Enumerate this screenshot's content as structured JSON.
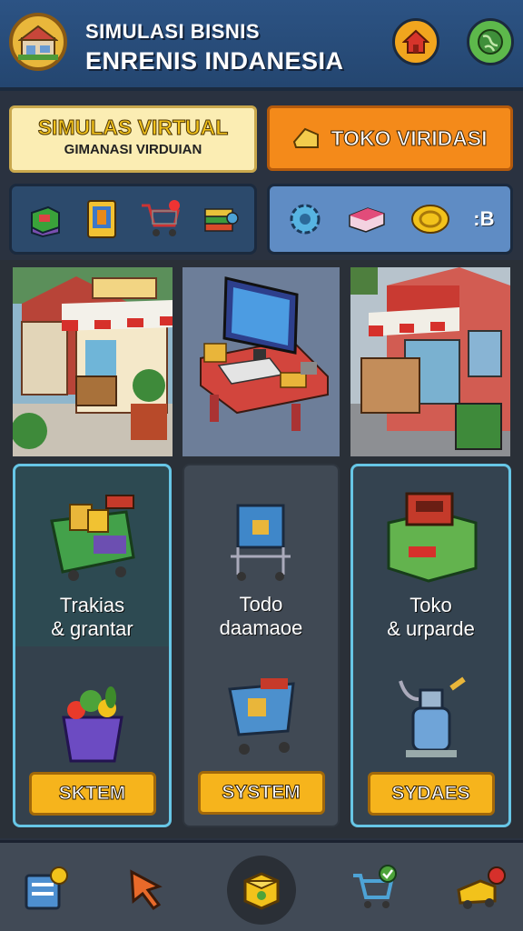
{
  "header": {
    "title_line1": "SIMULASI BISNIS",
    "title_line2": "ENRENIS INDANESIA",
    "logo_icon": "shop-house-icon",
    "home_icon": "home-icon",
    "globe_icon": "globe-icon"
  },
  "top_buttons": {
    "virtual_main": "SIMULAS VIRTUAL",
    "virtual_sub": "GIMANASI VIRDUIAN",
    "toko_label": "TOKO VIRIDASI"
  },
  "icon_bar_left": [
    "crate-icon",
    "card-icon",
    "cart-icon",
    "stack-icon"
  ],
  "icon_bar_right": {
    "icons": [
      "gear-icon",
      "box-icon",
      "coin-icon"
    ],
    "count": ":B"
  },
  "cards": [
    {
      "title_line1": "Trakias",
      "title_line2": "& grantar",
      "button": "SKTEM"
    },
    {
      "title_line1": "Todo",
      "title_line2": "daamaoe",
      "button": "SYSTEM"
    },
    {
      "title_line1": "Toko",
      "title_line2": "& urparde",
      "button": "SYDAES"
    }
  ],
  "nav": [
    "report-icon",
    "cursor-icon",
    "box-icon",
    "cart-check-icon",
    "truck-icon"
  ],
  "colors": {
    "header": "#2c5384",
    "accent_orange": "#f48a1a",
    "button_yellow": "#f6b41c",
    "card_highlight": "#67c6e6"
  }
}
